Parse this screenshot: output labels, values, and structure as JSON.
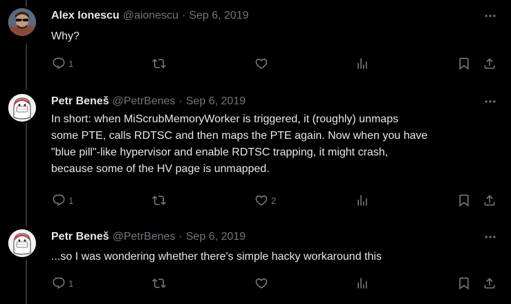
{
  "tweets": [
    {
      "name": "Alex Ionescu",
      "handle": "@aionescu",
      "separator": "·",
      "date": "Sep 6, 2019",
      "lines": [
        "Why?"
      ],
      "reply_count": "1",
      "retweet_count": "",
      "like_count": ""
    },
    {
      "name": "Petr Beneš",
      "handle": "@PetrBenes",
      "separator": "·",
      "date": "Sep 6, 2019",
      "lines": [
        "In short: when MiScrubMemoryWorker is triggered, it (roughly) unmaps",
        "some PTE, calls RDTSC and then maps the PTE again. Now when you have",
        "\"blue pill\"-like hypervisor and enable RDTSC trapping, it might crash,",
        "because some of the HV page is unmapped."
      ],
      "reply_count": "1",
      "retweet_count": "",
      "like_count": "2"
    },
    {
      "name": "Petr Beneš",
      "handle": "@PetrBenes",
      "separator": "·",
      "date": "Sep 6, 2019",
      "lines": [
        "...so I was wondering whether there's simple hacky workaround this"
      ],
      "reply_count": "1",
      "retweet_count": "",
      "like_count": ""
    }
  ],
  "icons": {
    "more": "more-icon",
    "reply": "reply-icon",
    "retweet": "retweet-icon",
    "like": "like-icon",
    "views": "views-icon",
    "bookmark": "bookmark-icon",
    "share": "share-icon"
  },
  "colors": {
    "background": "#000000",
    "text": "#e7e9ea",
    "secondary": "#71767b",
    "thread_line": "#333639"
  }
}
